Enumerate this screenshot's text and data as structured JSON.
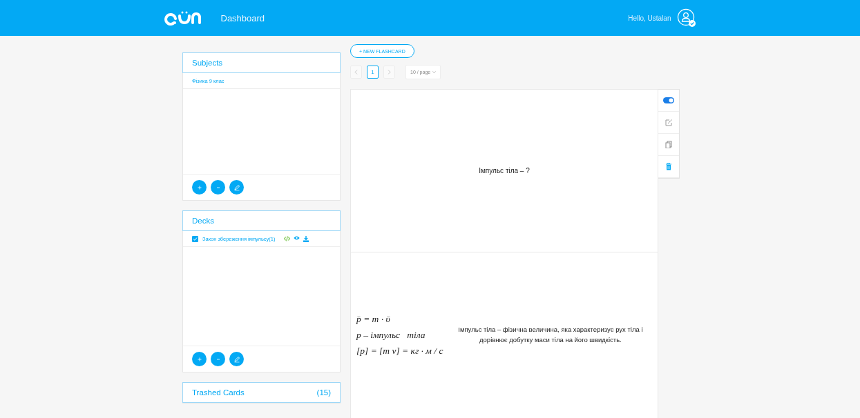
{
  "header": {
    "nav": [
      {
        "label": "Dashboard"
      }
    ],
    "greeting": "Hello, Ustalan"
  },
  "subjects": {
    "title": "Subjects",
    "items": [
      {
        "label": "Фізика 9 клас",
        "selected": false
      }
    ]
  },
  "decks": {
    "title": "Decks",
    "items": [
      {
        "label": "Закон збереження імпульсу(1)",
        "checked": true
      }
    ]
  },
  "trash": {
    "title": "Trashed Cards",
    "count": "(15)"
  },
  "new_button": "+ NEW FLASHCARD",
  "pagination": {
    "prev_disabled": true,
    "next_disabled": true,
    "pages": [
      {
        "label": "1",
        "selected": true
      }
    ],
    "page_size": "10 / page"
  },
  "card": {
    "front": "Імпульс тіла – ?",
    "formula": [
      "p̄ = m · ῡ",
      "p – імпульс   тіла",
      "[p] = [m v] = кг · м / с"
    ],
    "back": "Імпульс тіла – фізична величина, яка характеризує рух тіла і дорівнює добутку маси тіла на його швидкість."
  },
  "card_tools": {
    "toggle_on": true
  }
}
